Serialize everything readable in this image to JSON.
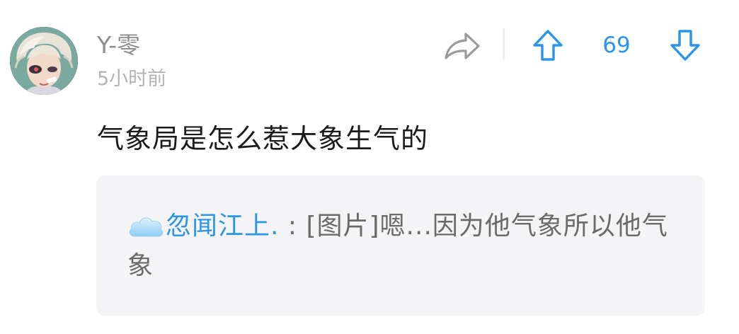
{
  "comment": {
    "username": "Y-零",
    "timestamp": "5小时前",
    "score": "69",
    "body": "气象局是怎么惹大象生气的",
    "icons": {
      "share": "share-icon",
      "upvote": "arrow-up-icon",
      "downvote": "arrow-down-icon"
    },
    "reply": {
      "username": "忽闻江上.",
      "separator": " : ",
      "text": "[图片]嗯...因为他气象所以他气象"
    }
  },
  "colors": {
    "accent": "#2b95e8",
    "username": "#8d8d8d",
    "timestamp": "#b3b3b3",
    "body": "#1b1b1b",
    "quote_bg": "#f4f4f6",
    "quote_text": "#6a6a6a",
    "icon_gray": "#9a9a9a"
  }
}
